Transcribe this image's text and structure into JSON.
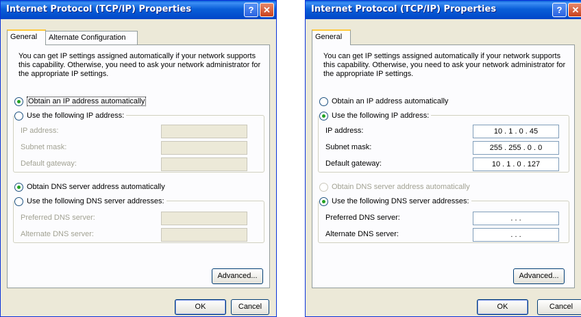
{
  "dialog1": {
    "title": "Internet Protocol (TCP/IP) Properties",
    "help_button": "?",
    "close_button": "✕",
    "tabs": [
      "General",
      "Alternate Configuration"
    ],
    "intro": "You can get IP settings assigned automatically if your network supports this capability. Otherwise, you need to ask your network administrator for the appropriate IP settings.",
    "radio_ip_auto": "Obtain an IP address automatically",
    "radio_ip_manual": "Use the following IP address:",
    "ip_label": "IP address:",
    "subnet_label": "Subnet mask:",
    "gateway_label": "Default gateway:",
    "ip_value": "",
    "subnet_value": "",
    "gateway_value": "",
    "radio_dns_auto": "Obtain DNS server address automatically",
    "radio_dns_manual": "Use the following DNS server addresses:",
    "pref_dns_label": "Preferred DNS server:",
    "alt_dns_label": "Alternate DNS server:",
    "pref_dns_value": "",
    "alt_dns_value": "",
    "advanced": "Advanced...",
    "ok": "OK",
    "cancel": "Cancel"
  },
  "dialog2": {
    "title": "Internet Protocol (TCP/IP) Properties",
    "help_button": "?",
    "close_button": "✕",
    "tabs": [
      "General"
    ],
    "intro": "You can get IP settings assigned automatically if your network supports this capability. Otherwise, you need to ask your network administrator for the appropriate IP settings.",
    "radio_ip_auto": "Obtain an IP address automatically",
    "radio_ip_manual": "Use the following IP address:",
    "ip_label": "IP address:",
    "subnet_label": "Subnet mask:",
    "gateway_label": "Default gateway:",
    "ip_value": "10 . 1 . 0 . 45",
    "subnet_value": "255 . 255 . 0 . 0",
    "gateway_value": "10 . 1 . 0 . 127",
    "radio_dns_auto": "Obtain DNS server address automatically",
    "radio_dns_manual": "Use the following DNS server addresses:",
    "pref_dns_label": "Preferred DNS server:",
    "alt_dns_label": "Alternate DNS server:",
    "pref_dns_value": ". . .",
    "alt_dns_value": ". . .",
    "advanced": "Advanced...",
    "ok": "OK",
    "cancel": "Cancel"
  }
}
